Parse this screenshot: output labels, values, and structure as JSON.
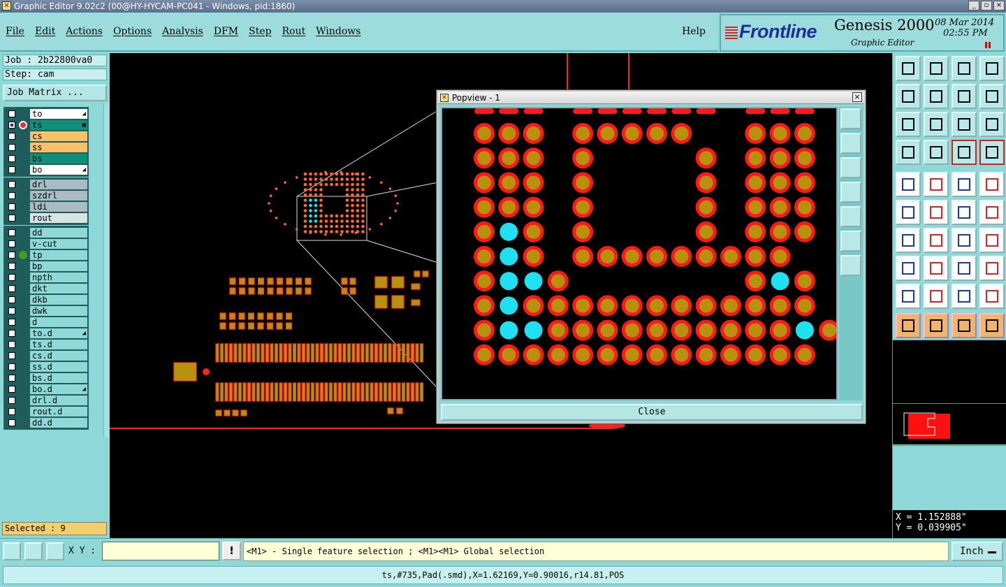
{
  "window": {
    "title": "Graphic Editor 9.02c2 (00@HY-HYCAM-PC041 - Windows, pid:1860)",
    "controls": [
      "_",
      "▫",
      "×"
    ]
  },
  "menu": {
    "items": [
      "File",
      "Edit",
      "Actions",
      "Options",
      "Analysis",
      "DFM",
      "Step",
      "Rout",
      "Windows"
    ],
    "help": "Help"
  },
  "brand": {
    "logo": "Frontline",
    "product": "Genesis 2000",
    "subtitle": "Graphic Editor",
    "date": "08 Mar 2014",
    "time": "02:55 PM"
  },
  "job": {
    "job": "Job : 2b22800va0",
    "step": "Step: cam",
    "matrix_button": "Job Matrix ..."
  },
  "layers": {
    "group1": [
      {
        "name": "to",
        "color": "#ffffff",
        "tail": "◢",
        "checked": false
      },
      {
        "name": "ts",
        "color": "#0f8f7a",
        "tail": "▦",
        "checked": true
      },
      {
        "name": "cs",
        "color": "#f5c16a",
        "tail": "",
        "checked": false
      },
      {
        "name": "ss",
        "color": "#f5c16a",
        "tail": "",
        "checked": false
      },
      {
        "name": "bs",
        "color": "#0f8f7a",
        "tail": "",
        "checked": false
      },
      {
        "name": "bo",
        "color": "#ffffff",
        "tail": "◢",
        "checked": false
      }
    ],
    "group2": [
      {
        "name": "drl",
        "color": "#a9bcc4",
        "tail": ""
      },
      {
        "name": "szdrl",
        "color": "#a9bcc4",
        "tail": ""
      },
      {
        "name": "ldi",
        "color": "#a9bcc4",
        "tail": ""
      },
      {
        "name": "rout",
        "color": "#d8e4e4",
        "tail": ""
      }
    ],
    "group3": [
      {
        "name": "dd",
        "color": "#8fd8d8",
        "tail": ""
      },
      {
        "name": "v-cut",
        "color": "#8fd8d8",
        "tail": ""
      },
      {
        "name": "tp",
        "color": "#8fd8d8",
        "tail": ""
      },
      {
        "name": "bp",
        "color": "#8fd8d8",
        "tail": ""
      },
      {
        "name": "npth",
        "color": "#8fd8d8",
        "tail": ""
      },
      {
        "name": "dkt",
        "color": "#8fd8d8",
        "tail": ""
      },
      {
        "name": "dkb",
        "color": "#8fd8d8",
        "tail": ""
      },
      {
        "name": "dwk",
        "color": "#8fd8d8",
        "tail": ""
      },
      {
        "name": "d",
        "color": "#8fd8d8",
        "tail": ""
      },
      {
        "name": "to.d",
        "color": "#8fd8d8",
        "tail": "◢"
      },
      {
        "name": "ts.d",
        "color": "#8fd8d8",
        "tail": ""
      },
      {
        "name": "cs.d",
        "color": "#8fd8d8",
        "tail": ""
      },
      {
        "name": "ss.d",
        "color": "#8fd8d8",
        "tail": ""
      },
      {
        "name": "bs.d",
        "color": "#8fd8d8",
        "tail": ""
      },
      {
        "name": "bo.d",
        "color": "#8fd8d8",
        "tail": "◢"
      },
      {
        "name": "drl.d",
        "color": "#8fd8d8",
        "tail": ""
      },
      {
        "name": "rout.d",
        "color": "#8fd8d8",
        "tail": ""
      },
      {
        "name": "dd.d",
        "color": "#8fd8d8",
        "tail": ""
      }
    ],
    "selected": "Selected : 9"
  },
  "popview": {
    "title": "Popview - 1",
    "close_button": "Close",
    "pad_grid": [
      "ooo.ooooo..ooo",
      "ooo.o....o.ooo",
      "ooo.o....o.ooo",
      "ooo.o....o.ooo",
      "oco.o....o.ooo",
      "oco.ooooooooo",
      "occo.......oco",
      "ocoooooooooooo",
      "occooooooooooco",
      "oooooooooooooo"
    ]
  },
  "colors": {
    "pad_outer": "#ff1a1a",
    "pad_inner": "#b8900f",
    "pad_selected": "#1fe0f0",
    "canvas_bg": "#000000"
  },
  "coords": {
    "x": "X = 1.152888\"",
    "y": "Y = 0.039905\""
  },
  "bottom": {
    "xy_label": "X Y :",
    "xy_value": "",
    "bang": "!",
    "message": "<M1> - Single feature selection ; <M1><M1> Global selection",
    "unit": "Inch"
  },
  "status": {
    "text": "ts,#735,Pad(.smd),X=1.62169,Y=0.90016,r14.81,POS"
  }
}
